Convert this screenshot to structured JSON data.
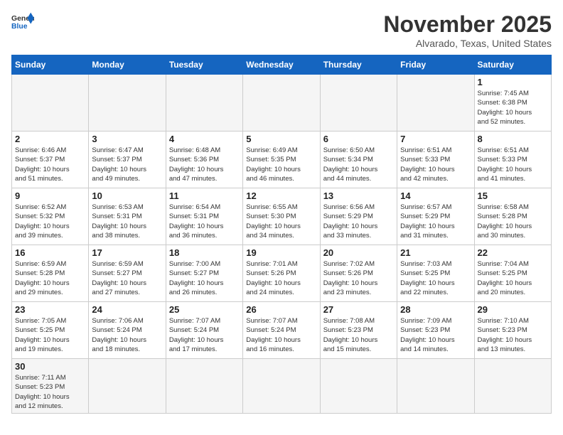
{
  "header": {
    "logo_general": "General",
    "logo_blue": "Blue",
    "month_title": "November 2025",
    "location": "Alvarado, Texas, United States"
  },
  "weekdays": [
    "Sunday",
    "Monday",
    "Tuesday",
    "Wednesday",
    "Thursday",
    "Friday",
    "Saturday"
  ],
  "weeks": [
    [
      {
        "day": "",
        "info": ""
      },
      {
        "day": "",
        "info": ""
      },
      {
        "day": "",
        "info": ""
      },
      {
        "day": "",
        "info": ""
      },
      {
        "day": "",
        "info": ""
      },
      {
        "day": "",
        "info": ""
      },
      {
        "day": "1",
        "info": "Sunrise: 7:45 AM\nSunset: 6:38 PM\nDaylight: 10 hours\nand 52 minutes."
      }
    ],
    [
      {
        "day": "2",
        "info": "Sunrise: 6:46 AM\nSunset: 5:37 PM\nDaylight: 10 hours\nand 51 minutes."
      },
      {
        "day": "3",
        "info": "Sunrise: 6:47 AM\nSunset: 5:37 PM\nDaylight: 10 hours\nand 49 minutes."
      },
      {
        "day": "4",
        "info": "Sunrise: 6:48 AM\nSunset: 5:36 PM\nDaylight: 10 hours\nand 47 minutes."
      },
      {
        "day": "5",
        "info": "Sunrise: 6:49 AM\nSunset: 5:35 PM\nDaylight: 10 hours\nand 46 minutes."
      },
      {
        "day": "6",
        "info": "Sunrise: 6:50 AM\nSunset: 5:34 PM\nDaylight: 10 hours\nand 44 minutes."
      },
      {
        "day": "7",
        "info": "Sunrise: 6:51 AM\nSunset: 5:33 PM\nDaylight: 10 hours\nand 42 minutes."
      },
      {
        "day": "8",
        "info": "Sunrise: 6:51 AM\nSunset: 5:33 PM\nDaylight: 10 hours\nand 41 minutes."
      }
    ],
    [
      {
        "day": "9",
        "info": "Sunrise: 6:52 AM\nSunset: 5:32 PM\nDaylight: 10 hours\nand 39 minutes."
      },
      {
        "day": "10",
        "info": "Sunrise: 6:53 AM\nSunset: 5:31 PM\nDaylight: 10 hours\nand 38 minutes."
      },
      {
        "day": "11",
        "info": "Sunrise: 6:54 AM\nSunset: 5:31 PM\nDaylight: 10 hours\nand 36 minutes."
      },
      {
        "day": "12",
        "info": "Sunrise: 6:55 AM\nSunset: 5:30 PM\nDaylight: 10 hours\nand 34 minutes."
      },
      {
        "day": "13",
        "info": "Sunrise: 6:56 AM\nSunset: 5:29 PM\nDaylight: 10 hours\nand 33 minutes."
      },
      {
        "day": "14",
        "info": "Sunrise: 6:57 AM\nSunset: 5:29 PM\nDaylight: 10 hours\nand 31 minutes."
      },
      {
        "day": "15",
        "info": "Sunrise: 6:58 AM\nSunset: 5:28 PM\nDaylight: 10 hours\nand 30 minutes."
      }
    ],
    [
      {
        "day": "16",
        "info": "Sunrise: 6:59 AM\nSunset: 5:28 PM\nDaylight: 10 hours\nand 29 minutes."
      },
      {
        "day": "17",
        "info": "Sunrise: 6:59 AM\nSunset: 5:27 PM\nDaylight: 10 hours\nand 27 minutes."
      },
      {
        "day": "18",
        "info": "Sunrise: 7:00 AM\nSunset: 5:27 PM\nDaylight: 10 hours\nand 26 minutes."
      },
      {
        "day": "19",
        "info": "Sunrise: 7:01 AM\nSunset: 5:26 PM\nDaylight: 10 hours\nand 24 minutes."
      },
      {
        "day": "20",
        "info": "Sunrise: 7:02 AM\nSunset: 5:26 PM\nDaylight: 10 hours\nand 23 minutes."
      },
      {
        "day": "21",
        "info": "Sunrise: 7:03 AM\nSunset: 5:25 PM\nDaylight: 10 hours\nand 22 minutes."
      },
      {
        "day": "22",
        "info": "Sunrise: 7:04 AM\nSunset: 5:25 PM\nDaylight: 10 hours\nand 20 minutes."
      }
    ],
    [
      {
        "day": "23",
        "info": "Sunrise: 7:05 AM\nSunset: 5:25 PM\nDaylight: 10 hours\nand 19 minutes."
      },
      {
        "day": "24",
        "info": "Sunrise: 7:06 AM\nSunset: 5:24 PM\nDaylight: 10 hours\nand 18 minutes."
      },
      {
        "day": "25",
        "info": "Sunrise: 7:07 AM\nSunset: 5:24 PM\nDaylight: 10 hours\nand 17 minutes."
      },
      {
        "day": "26",
        "info": "Sunrise: 7:07 AM\nSunset: 5:24 PM\nDaylight: 10 hours\nand 16 minutes."
      },
      {
        "day": "27",
        "info": "Sunrise: 7:08 AM\nSunset: 5:23 PM\nDaylight: 10 hours\nand 15 minutes."
      },
      {
        "day": "28",
        "info": "Sunrise: 7:09 AM\nSunset: 5:23 PM\nDaylight: 10 hours\nand 14 minutes."
      },
      {
        "day": "29",
        "info": "Sunrise: 7:10 AM\nSunset: 5:23 PM\nDaylight: 10 hours\nand 13 minutes."
      }
    ],
    [
      {
        "day": "30",
        "info": "Sunrise: 7:11 AM\nSunset: 5:23 PM\nDaylight: 10 hours\nand 12 minutes."
      },
      {
        "day": "",
        "info": ""
      },
      {
        "day": "",
        "info": ""
      },
      {
        "day": "",
        "info": ""
      },
      {
        "day": "",
        "info": ""
      },
      {
        "day": "",
        "info": ""
      },
      {
        "day": "",
        "info": ""
      }
    ]
  ]
}
